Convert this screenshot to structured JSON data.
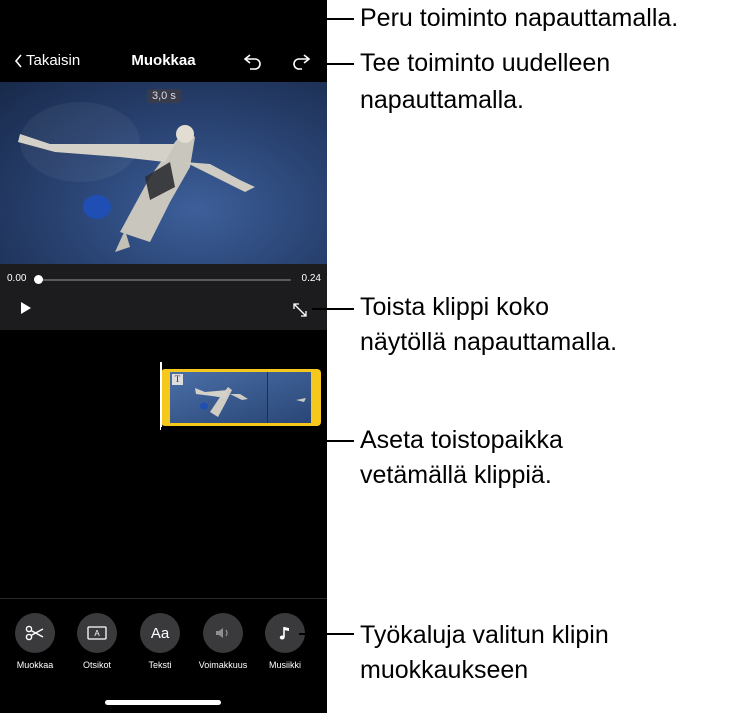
{
  "nav": {
    "back_label": "Takaisin",
    "title": "Muokkaa"
  },
  "video": {
    "duration_badge": "3,0 s"
  },
  "playback": {
    "time_start": "0.00",
    "time_end": "0.24",
    "progress": 0.0
  },
  "clip": {
    "title_badge": "T"
  },
  "toolbar": {
    "items": [
      {
        "label": "Muokkaa",
        "icon": "scissors-icon"
      },
      {
        "label": "Otsikot",
        "icon": "titles-icon"
      },
      {
        "label": "Teksti",
        "icon_text": "Aa",
        "label2": "Teksti"
      },
      {
        "label": "Voimakkuus",
        "icon": "speaker-icon"
      },
      {
        "label": "Musiikki",
        "icon": "music-note-icon"
      }
    ]
  },
  "callouts": {
    "undo": "Peru toiminto napauttamalla.",
    "redo_1": "Tee toiminto uudelleen",
    "redo_2": "napauttamalla.",
    "fullscreen_1": "Toista klippi koko",
    "fullscreen_2": "näytöllä napauttamalla.",
    "playhead_1": "Aseta toistopaikka",
    "playhead_2": "vetämällä klippiä.",
    "tools_1": "Työkaluja valitun klipin",
    "tools_2": "muokkaukseen"
  }
}
